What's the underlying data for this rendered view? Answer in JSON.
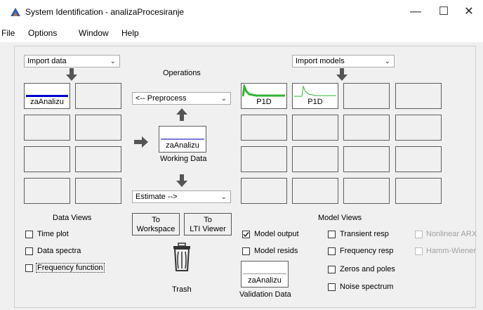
{
  "window": {
    "title": "System Identification - analizaProcesiranje",
    "controls": [
      "—",
      "☐",
      "✕"
    ]
  },
  "menu": [
    "File",
    "Options",
    "Window",
    "Help"
  ],
  "import_data": {
    "value": "Import data"
  },
  "import_models": {
    "value": "Import models"
  },
  "operations_label": "Operations",
  "preprocess": {
    "value": "<-- Preprocess"
  },
  "estimate": {
    "value": "Estimate -->"
  },
  "data_board": {
    "filled_label": "zaAnalizu",
    "line_color": "#0000cc"
  },
  "working_data": {
    "name": "zaAnalizu",
    "caption": "Working Data"
  },
  "model_board": [
    {
      "label": "P1D",
      "color": "#33b333"
    },
    {
      "label": "P1D",
      "color": "#33b333"
    }
  ],
  "data_views": {
    "title": "Data Views",
    "items": [
      "Time plot",
      "Data spectra",
      "Frequency function"
    ]
  },
  "buttons": {
    "to_workspace": [
      "To",
      "Workspace"
    ],
    "to_lti": [
      "To",
      "LTI Viewer"
    ]
  },
  "trash_label": "Trash",
  "model_views": {
    "title": "Model Views",
    "col1": [
      {
        "label": "Model output",
        "checked": true
      },
      {
        "label": "Model resids",
        "checked": false
      }
    ],
    "col2": [
      "Transient resp",
      "Frequency resp",
      "Zeros and poles",
      "Noise spectrum"
    ],
    "col3": [
      "Nonlinear ARX",
      "Hamm-Wiener"
    ]
  },
  "validation": {
    "name": "zaAnalizu",
    "caption": "Validation Data"
  }
}
